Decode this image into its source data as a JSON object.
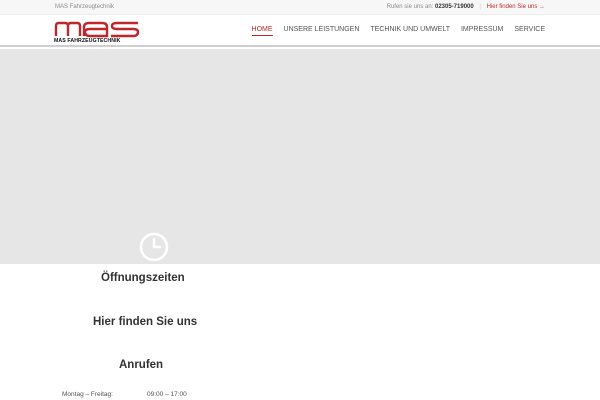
{
  "topbar": {
    "site_name": "MAS Fahrzeugtechnik",
    "call_label": "Rufen sie uns an:",
    "phone": "02305-719000",
    "find_link": "Hier finden Sie uns →"
  },
  "logo": {
    "mark": "mas",
    "text": "MAS FAHRZEUGTECHNIK",
    "color": "#c0272d"
  },
  "nav": {
    "items": [
      {
        "label": "HOME",
        "active": true
      },
      {
        "label": "UNSERE LEISTUNGEN",
        "active": false
      },
      {
        "label": "TECHNIK UND UMWELT",
        "active": false
      },
      {
        "label": "IMPRESSUM",
        "active": false
      },
      {
        "label": "SERVICE",
        "active": false
      }
    ]
  },
  "hero": {
    "background": "#e6e6e6",
    "icon": "clock-icon"
  },
  "sections": {
    "hours_title": "Öffnungszeiten",
    "find_title": "Hier finden Sie uns",
    "call_title": "Anrufen"
  },
  "hours": [
    {
      "day": "Montag – Freitag:",
      "time": "09:00 – 17:00"
    }
  ],
  "colors": {
    "accent": "#c0272d",
    "topbar_bg": "#f7f7f7",
    "text": "#333333"
  }
}
